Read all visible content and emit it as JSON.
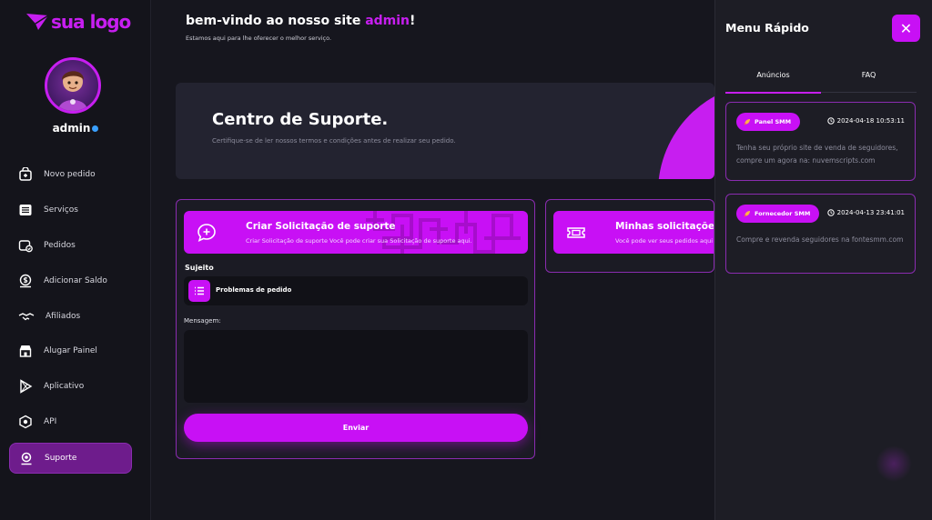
{
  "brand": {
    "logo_text": "sua logo",
    "accent": "#c810f5"
  },
  "user": {
    "name": "admin"
  },
  "sidebar": {
    "items": [
      {
        "label": "Novo pedido",
        "icon": "cart-plus-icon"
      },
      {
        "label": "Serviços",
        "icon": "list-icon"
      },
      {
        "label": "Pedidos",
        "icon": "orders-check-icon"
      },
      {
        "label": "Adicionar Saldo",
        "icon": "wallet-dollar-icon"
      },
      {
        "label": "Afiliados",
        "icon": "handshake-icon"
      },
      {
        "label": "Alugar Painel",
        "icon": "store-icon"
      },
      {
        "label": "Aplicativo",
        "icon": "play-store-icon"
      },
      {
        "label": "API",
        "icon": "cube-icon"
      },
      {
        "label": "Suporte",
        "icon": "headset-icon",
        "active": true
      }
    ]
  },
  "header": {
    "welcome_prefix": "bem-vindo ao nosso site ",
    "welcome_name": "admin",
    "welcome_suffix": "!",
    "subtitle": "Estamos aqui para lhe oferecer o melhor serviço."
  },
  "hero": {
    "title": "Centro de Suporte.",
    "subtitle": "Certifique-se de ler nossos termos e condições antes de realizar seu pedido."
  },
  "create_ticket": {
    "title": "Criar Solicitação de suporte",
    "subtitle": "Criar Solicitação de suporte Você pode criar sua Solicitação de suporte aqui.",
    "subject_label": "Sujeito",
    "subject_value": "Problemas de pedido",
    "message_label": "Mensagem:",
    "message_value": "",
    "send_label": "Enviar"
  },
  "my_tickets": {
    "title": "Minhas solicitações de",
    "subtitle": "Você pode ver seus pedidos aqui"
  },
  "quick_menu": {
    "title": "Menu Rápido",
    "close_label": "✕",
    "tabs": [
      {
        "label": "Anúncios",
        "active": true
      },
      {
        "label": "FAQ"
      }
    ],
    "notices": [
      {
        "badge": "Panel SMM",
        "date": "2024-04-18 10:53:11",
        "text": "Tenha seu próprio site de venda de seguidores, compre um agora na: nuvemscripts.com"
      },
      {
        "badge": "Fornecedor SMM",
        "date": "2024-04-13 23:41:01",
        "text": "Compre e revenda seguidores na fontesmm.com"
      }
    ]
  }
}
